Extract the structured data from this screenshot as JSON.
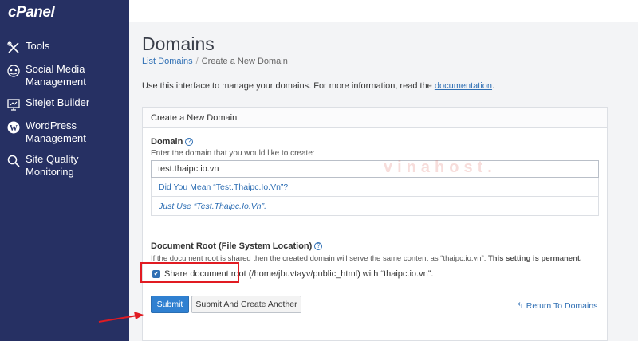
{
  "sidebar": {
    "logo": "cPanel",
    "items": [
      {
        "label": "Tools",
        "icon": "tools-icon"
      },
      {
        "label": "Social Media Management",
        "icon": "social-icon"
      },
      {
        "label": "Sitejet Builder",
        "icon": "sitejet-icon"
      },
      {
        "label": "WordPress Management",
        "icon": "wordpress-icon"
      },
      {
        "label": "Site Quality Monitoring",
        "icon": "search-quality-icon"
      }
    ]
  },
  "main": {
    "title": "Domains",
    "breadcrumb": {
      "parent": "List Domains",
      "sep": "/",
      "current": "Create a New Domain"
    },
    "intro_text": "Use this interface to manage your domains. For more information, read the",
    "intro_link": "documentation",
    "intro_end": "."
  },
  "panel": {
    "heading": "Create a New Domain",
    "domain_label": "Domain",
    "domain_sub": "Enter the domain that you would like to create:",
    "domain_value": "test.thaipc.io.vn",
    "suggestion_1": "Did You Mean “Test.Thaipc.Io.Vn”?",
    "suggestion_2": "Just Use “Test.Thaipc.Io.Vn”.",
    "watermark": "vinahost.",
    "docroot_label": "Document Root (File System Location)",
    "docroot_sub": "If the document root is shared then the created domain will serve the same content as “thaipc.io.vn”.",
    "docroot_sub_bold": "This setting is permanent.",
    "share_label": "Share document root",
    "share_path": "(/home/jbuvtayv/public_html) with “thaipc.io.vn”.",
    "submit_label": "Submit",
    "submit_another_label": "Submit And Create Another",
    "return_label": "Return To Domains"
  },
  "colors": {
    "sidebar": "#263063",
    "accent": "#2f80d1",
    "highlight": "#e11b22"
  }
}
